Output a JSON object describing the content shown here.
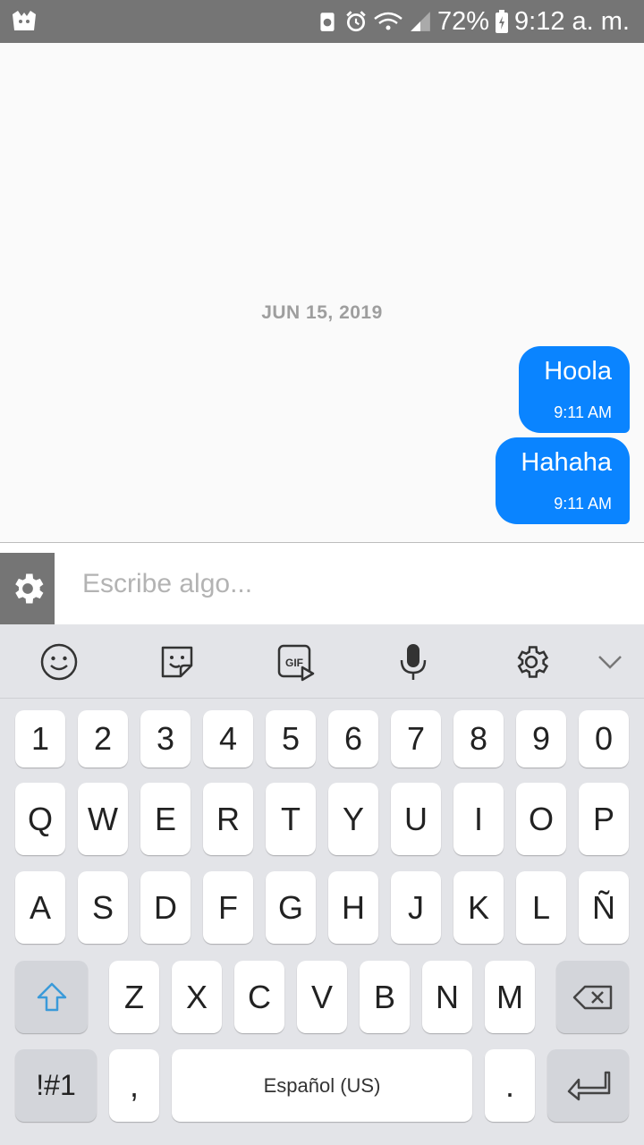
{
  "status_bar": {
    "battery_percent": "72%",
    "time": "9:12 a. m."
  },
  "chat": {
    "date_separator": "JUN 15, 2019",
    "messages": [
      {
        "text": "Hoola",
        "time": "9:11 AM"
      },
      {
        "text": "Hahaha",
        "time": "9:11 AM"
      }
    ]
  },
  "composer": {
    "placeholder": "Escribe algo..."
  },
  "keyboard": {
    "toolbar_icons": [
      "emoji-icon",
      "sticker-icon",
      "gif-icon",
      "microphone-icon",
      "settings-icon",
      "collapse-icon"
    ],
    "gif_label": "GIF",
    "row_numbers": [
      "1",
      "2",
      "3",
      "4",
      "5",
      "6",
      "7",
      "8",
      "9",
      "0"
    ],
    "row_1": [
      "Q",
      "W",
      "E",
      "R",
      "T",
      "Y",
      "U",
      "I",
      "O",
      "P"
    ],
    "row_2": [
      "A",
      "S",
      "D",
      "F",
      "G",
      "H",
      "J",
      "K",
      "L",
      "Ñ"
    ],
    "row_3": [
      "Z",
      "X",
      "C",
      "V",
      "B",
      "N",
      "M"
    ],
    "symbols_label": "!#1",
    "comma_label": ",",
    "space_label": "Español (US)",
    "period_label": "."
  },
  "colors": {
    "bubble": "#0a84ff",
    "status_bar": "#757575",
    "keyboard_bg": "#e3e4e8",
    "shift_icon": "#3a9ad9"
  }
}
